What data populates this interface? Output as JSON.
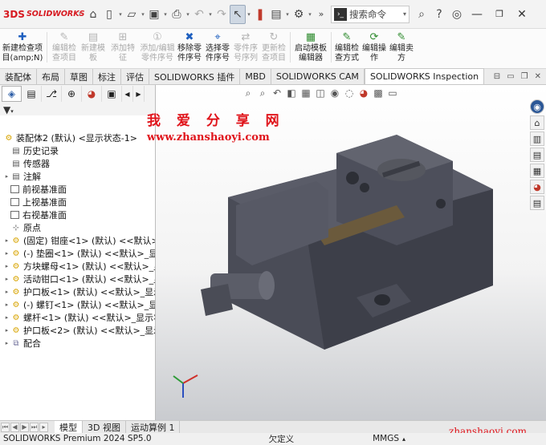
{
  "app": {
    "logo_ds": "3DS",
    "logo_name": "SOLIDWORKS"
  },
  "search": {
    "placeholder": "搜索命令"
  },
  "commands": [
    {
      "label": "新建检查项\n目(amp;N)",
      "icon": "new-inspection-icon",
      "disabled": false
    },
    {
      "label": "编辑检\n查项目",
      "icon": "edit-inspection-icon",
      "disabled": true
    },
    {
      "label": "新建模\n板",
      "icon": "new-template-icon",
      "disabled": true
    },
    {
      "label": "添加特\n征",
      "icon": "add-feature-icon",
      "disabled": true
    },
    {
      "label": "添加/编辑\n零件序号",
      "icon": "add-balloon-icon",
      "disabled": true
    },
    {
      "label": "移除零\n件序号",
      "icon": "remove-balloon-icon",
      "disabled": false
    },
    {
      "label": "选择零\n件序号",
      "icon": "select-balloon-icon",
      "disabled": false
    },
    {
      "label": "零件序\n号序列",
      "icon": "balloon-sequence-icon",
      "disabled": true
    },
    {
      "label": "更新检\n查项目",
      "icon": "update-inspection-icon",
      "disabled": true
    },
    {
      "label": "启动模板\n编辑器",
      "icon": "template-editor-icon",
      "disabled": false
    },
    {
      "label": "编辑检\n查方式",
      "icon": "edit-method-icon",
      "disabled": false
    },
    {
      "label": "编辑操\n作",
      "icon": "edit-operation-icon",
      "disabled": false
    },
    {
      "label": "编辑卖\n方",
      "icon": "edit-vendor-icon",
      "disabled": false
    }
  ],
  "tabs": [
    "装配体",
    "布局",
    "草图",
    "标注",
    "评估",
    "SOLIDWORKS 插件",
    "MBD",
    "SOLIDWORKS CAM",
    "SOLIDWORKS Inspection"
  ],
  "tree": {
    "root": "装配体2 (默认) <显示状态-1>",
    "nodes": [
      {
        "label": "历史记录",
        "type": "folder"
      },
      {
        "label": "传感器",
        "type": "folder"
      },
      {
        "label": "注解",
        "type": "folder"
      },
      {
        "label": "前视基准面",
        "type": "plane"
      },
      {
        "label": "上视基准面",
        "type": "plane"
      },
      {
        "label": "右视基准面",
        "type": "plane"
      },
      {
        "label": "原点",
        "type": "origin"
      },
      {
        "label": "(固定) 钳座<1> (默认) <<默认>_显",
        "type": "part"
      },
      {
        "label": "(-) 垫圈<1> (默认) <<默认>_显示状",
        "type": "part"
      },
      {
        "label": "方块螺母<1> (默认) <<默认>_显示",
        "type": "part"
      },
      {
        "label": "活动钳口<1> (默认) <<默认>_显示",
        "type": "part"
      },
      {
        "label": "护口板<1> (默认) <<默认>_显示状",
        "type": "part"
      },
      {
        "label": "(-) 螺钉<1> (默认) <<默认>_显示状",
        "type": "part"
      },
      {
        "label": "螺杆<1> (默认) <<默认>_显示状态",
        "type": "part"
      },
      {
        "label": "护口板<2> (默认) <<默认>_显示状",
        "type": "part"
      },
      {
        "label": "配合",
        "type": "mate"
      }
    ]
  },
  "watermark": {
    "line1": "我 爱 分 享 网",
    "line2": "www.zhanshaoyi.com",
    "line3": "zhanshaoyi.com"
  },
  "bottom_tabs": [
    "模型",
    "3D 视图",
    "运动算例 1"
  ],
  "status": {
    "product": "SOLIDWORKS Premium 2024 SP5.0",
    "define": "欠定义",
    "units": "MMGS"
  }
}
